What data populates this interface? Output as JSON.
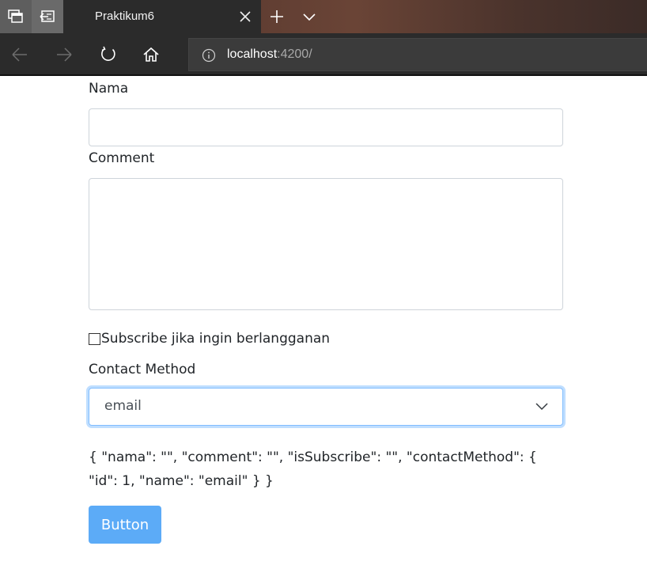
{
  "browser": {
    "tab_title": "Praktikum6",
    "url_host": "localhost",
    "url_rest": ":4200/",
    "icons": {
      "tab_preview": "tab-preview-icon",
      "set_aside": "set-aside-tabs-icon",
      "close": "close-icon",
      "new_tab": "plus-icon",
      "tab_menu": "chevron-down-icon",
      "back": "arrow-left-icon",
      "forward": "arrow-right-icon",
      "refresh": "refresh-icon",
      "home": "home-icon",
      "info": "info-icon"
    }
  },
  "form": {
    "nama_label": "Nama",
    "nama_value": "",
    "comment_label": "Comment",
    "comment_value": "",
    "subscribe_label": "Subscribe jika ingin berlangganan",
    "subscribe_checked": false,
    "contact_label": "Contact Method",
    "contact_selected": "email",
    "json_output": "{ \"nama\": \"\", \"comment\": \"\", \"isSubscribe\": \"\", \"contactMethod\": { \"id\": 1, \"name\": \"email\" } }",
    "button_label": "Button"
  },
  "colors": {
    "button_bg": "#5cabf7",
    "focus_border": "#80bdff",
    "chrome_dark": "#2b2b2b"
  }
}
